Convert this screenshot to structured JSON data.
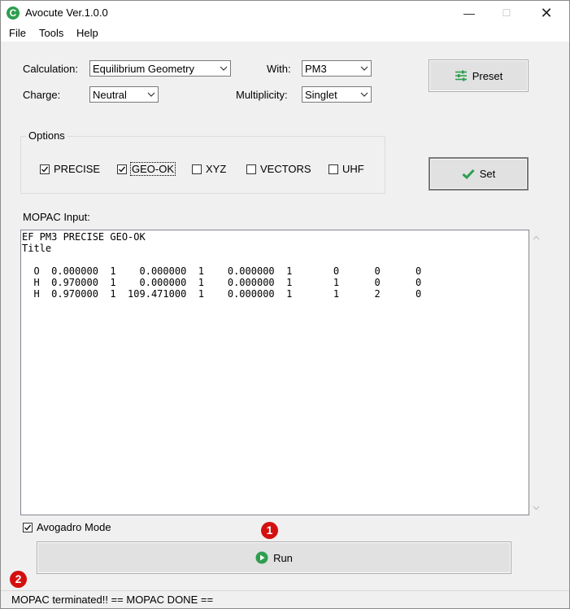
{
  "window": {
    "app_icon_letter": "C",
    "title": "Avocute Ver.1.0.0",
    "minimize_glyph": "—",
    "maximize_glyph": "☐",
    "close_glyph": "✕"
  },
  "menu": [
    "File",
    "Tools",
    "Help"
  ],
  "calculation": {
    "label": "Calculation:",
    "value": "Equilibrium Geometry"
  },
  "with": {
    "label": "With:",
    "value": "PM3"
  },
  "charge": {
    "label": "Charge:",
    "value": "Neutral"
  },
  "multiplicity": {
    "label": "Multiplicity:",
    "value": "Singlet"
  },
  "preset_button": {
    "label": "Preset",
    "icon": "sliders-icon"
  },
  "set_button": {
    "label": "Set",
    "icon": "checkmark-icon"
  },
  "options": {
    "title": "Options",
    "items": [
      {
        "label": "PRECISE",
        "checked": true
      },
      {
        "label": "GEO-OK",
        "checked": true,
        "focused": true
      },
      {
        "label": "XYZ",
        "checked": false
      },
      {
        "label": "VECTORS",
        "checked": false
      },
      {
        "label": "UHF",
        "checked": false
      }
    ]
  },
  "mopac_input": {
    "label": "MOPAC Input:",
    "text": "EF PM3 PRECISE GEO-OK\nTitle\n\n  O  0.000000  1    0.000000  1    0.000000  1       0      0      0\n  H  0.970000  1    0.000000  1    0.000000  1       1      0      0\n  H  0.970000  1  109.471000  1    0.000000  1       1      2      0"
  },
  "avogadro_mode": {
    "label": "Avogadro Mode",
    "checked": true
  },
  "run_button": {
    "label": "Run",
    "icon": "play-icon"
  },
  "markers": [
    "1",
    "2"
  ],
  "status": {
    "text": "MOPAC terminated!! == MOPAC DONE =="
  },
  "colors": {
    "accent_green": "#2e9e4f",
    "marker_red": "#d40f0f",
    "window_bg": "#f0f0f0"
  }
}
